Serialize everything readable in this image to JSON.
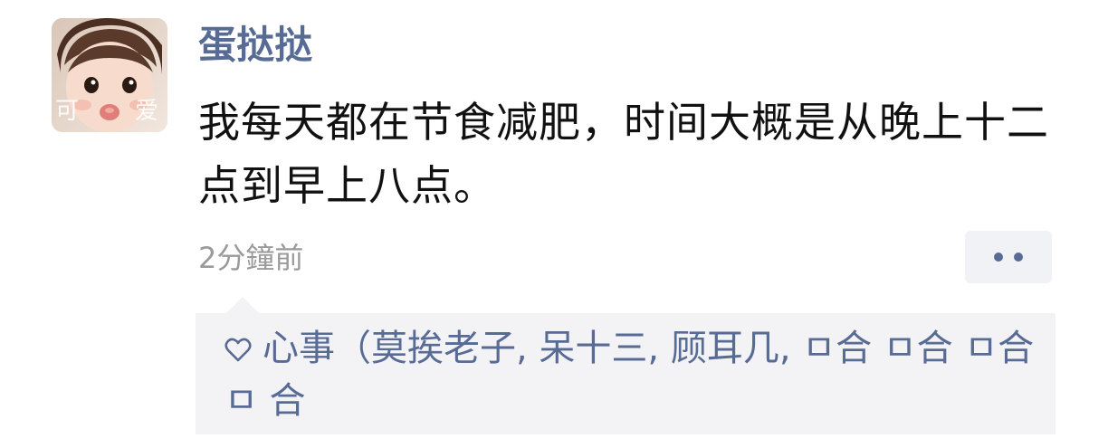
{
  "post": {
    "username": "蛋挞挞",
    "avatar_text_left": "可",
    "avatar_text_right": "爱",
    "text": "我每天都在节食减肥，时间大概是从晚上十二点到早上八点。",
    "timestamp": "2分鐘前",
    "more_icon": "more-dots-icon"
  },
  "likes": {
    "icon": "heart-outline-icon",
    "names": "心事（莫挨老子, 呆十三, 顾耳几, ㅁ合  ㅁ合  ㅁ合  ㅁ 合"
  },
  "colors": {
    "link": "#576b95",
    "text": "#111111",
    "muted": "#9a9a9a",
    "panel": "#f3f3f5"
  }
}
